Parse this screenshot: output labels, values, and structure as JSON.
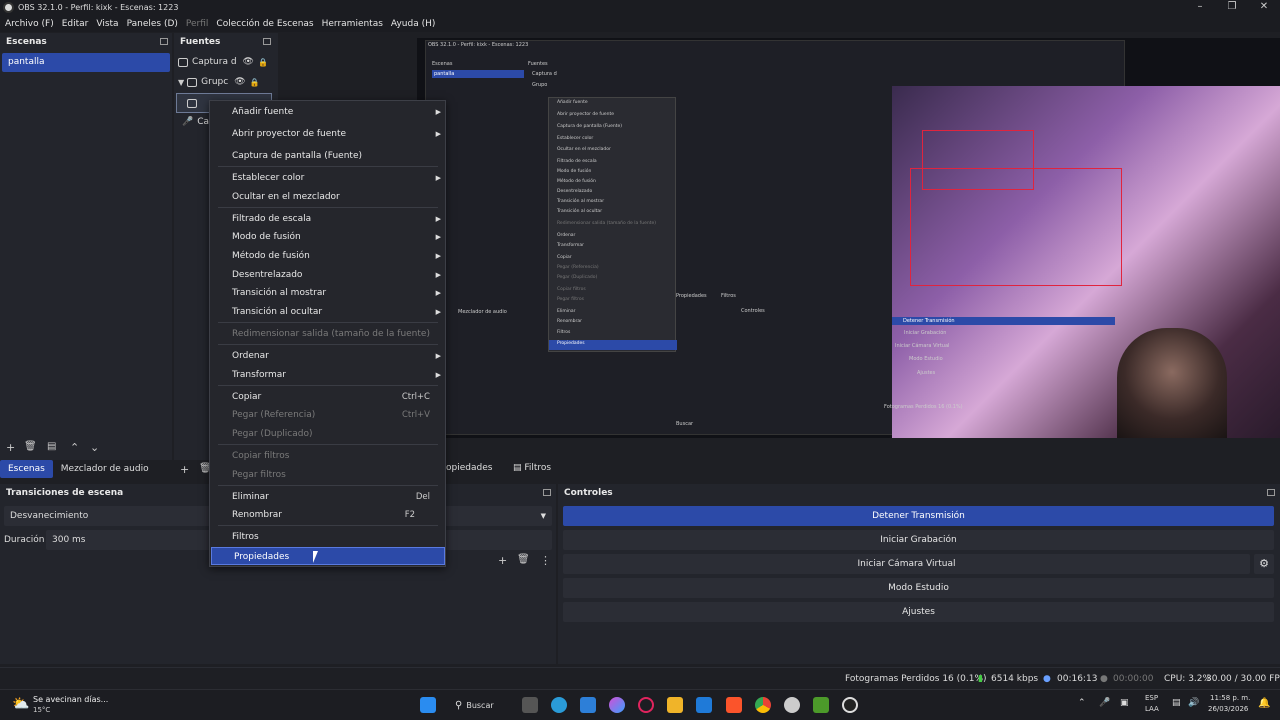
{
  "window": {
    "title": "OBS 32.1.0 - Perfil: kixk - Escenas: 1223"
  },
  "menu": [
    {
      "label": "Archivo (F)",
      "disabled": false
    },
    {
      "label": "Editar",
      "disabled": false
    },
    {
      "label": "Vista",
      "disabled": false
    },
    {
      "label": "Paneles (D)",
      "disabled": false
    },
    {
      "label": "Perfil",
      "disabled": true
    },
    {
      "label": "Colección de Escenas",
      "disabled": false
    },
    {
      "label": "Herramientas",
      "disabled": false
    },
    {
      "label": "Ayuda (H)",
      "disabled": false
    }
  ],
  "scenes": {
    "header": "Escenas",
    "items": [
      "pantalla"
    ]
  },
  "sources": {
    "header": "Fuentes",
    "items": [
      "Captura d",
      "Grupc",
      "",
      "Ca"
    ]
  },
  "bottom_tabs": {
    "scenes": "Escenas",
    "audio": "Mezclador de audio",
    "properties": "opiedades",
    "filters": "Filtros"
  },
  "transitions": {
    "header": "Transiciones de escena",
    "type": "Desvanecimiento",
    "duration_label": "Duración",
    "duration_value": "300 ms"
  },
  "controls": {
    "header": "Controles",
    "stop_stream": "Detener Transmisión",
    "start_recording": "Iniciar Grabación",
    "virtual_cam": "Iniciar Cámara Virtual",
    "studio_mode": "Modo Estudio",
    "settings": "Ajustes"
  },
  "context_menu": {
    "items": {
      "add_source": "Añadir fuente",
      "open_projector": "Abrir proyector de fuente",
      "screenshot": "Captura de pantalla (Fuente)",
      "set_color": "Establecer color",
      "hide_mixer": "Ocultar en el mezclador",
      "scale_filter": "Filtrado de escala",
      "blend_mode": "Modo de fusión",
      "blend_method": "Método de fusión",
      "deinterlace": "Desentrelazado",
      "show_transition": "Transición al mostrar",
      "hide_transition": "Transición al ocultar",
      "resize_output": "Redimensionar salida (tamaño de la fuente)",
      "order": "Ordenar",
      "transform": "Transformar",
      "copy": "Copiar",
      "copy_sc": "Ctrl+C",
      "paste_ref": "Pegar (Referencia)",
      "paste_ref_sc": "Ctrl+V",
      "paste_dup": "Pegar (Duplicado)",
      "copy_filters": "Copiar filtros",
      "paste_filters": "Pegar filtros",
      "remove": "Eliminar",
      "remove_sc": "Del",
      "rename": "Renombrar",
      "rename_sc": "F2",
      "filters": "Filtros",
      "properties": "Propiedades"
    }
  },
  "status": {
    "dropped": "Fotogramas Perdidos 16 (0.1%)",
    "bitrate": "6514 kbps",
    "stream_time": "00:16:13",
    "rec_time": "00:00:00",
    "cpu": "CPU: 3.2%",
    "fps": "30.00 / 30.00 FPS"
  },
  "taskbar": {
    "weather_title": "Se avecinan días...",
    "weather_temp": "15°C",
    "search": "Buscar",
    "lang1": "ESP",
    "lang2": "LAA",
    "time": "11:58 p. m.",
    "date": "26/03/2026"
  },
  "preview_texts": {
    "title": "OBS 32.1.0 - Perfil: kixk - Escenas: 1223",
    "scenes": "Escenas",
    "sources": "Fuentes",
    "scene_item": "pantalla",
    "src1": "Captura d",
    "src2": "Grupo",
    "search": "Buscar",
    "menu_items": [
      "Añadir fuente",
      "Abrir proyector de fuente",
      "Captura de pantalla (Fuente)",
      "Establecer color",
      "Ocultar en el mezclador",
      "Filtrado de escala",
      "Modo de fusión",
      "Método de fusión",
      "Desentrelazado",
      "Transición al mostrar",
      "Transición al ocultar",
      "Redimensionar salida (tamaño de la fuente)",
      "Ordenar",
      "Transformar",
      "Copiar",
      "Pegar (Referencia)",
      "Pegar (Duplicado)",
      "Copiar filtros",
      "Pegar filtros",
      "Eliminar",
      "Renombrar",
      "Filtros",
      "Propiedades"
    ],
    "controls": "Controles",
    "stop": "Detener Transmisión",
    "rec": "Iniciar Grabación",
    "vcam": "Iniciar Cámara Virtual",
    "studio": "Modo Estudio",
    "settings": "Ajustes",
    "audio": "Mezclador de audio",
    "props": "Propiedades",
    "filters": "Filtros",
    "dropped": "Fotogramas Perdidos 16 (0.1%)"
  },
  "colors": {
    "accent": "#2c4aa8",
    "bg": "#1e1f24",
    "panel": "#23252c",
    "red": "#e0243e"
  }
}
